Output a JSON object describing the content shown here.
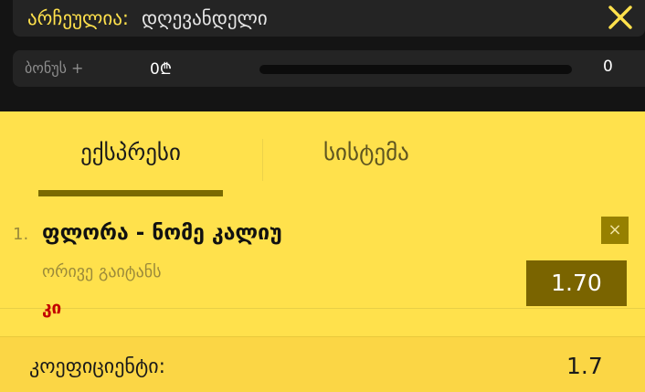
{
  "selection": {
    "label": "არჩეულია:",
    "value": "დღევანდელი"
  },
  "bonus": {
    "label": "ბონუს +",
    "amount": "0₾",
    "count": "0",
    "progress": 0
  },
  "tabs": [
    {
      "label": "ექსპრესი",
      "active": true
    },
    {
      "label": "სისტემა",
      "active": false
    }
  ],
  "bet": {
    "index": "1.",
    "event": "ფლორა - ნომე კალიუ",
    "market": "ორივე გაიტანს",
    "pick": "კი",
    "odd": "1.70",
    "remove_symbol": "×"
  },
  "total": {
    "label": "კოეფიციენტი:",
    "value": "1.7"
  },
  "colors": {
    "accent": "#ffe14c",
    "dark_bg": "#141414",
    "odd_box": "#7a6400",
    "pick_red": "#c20000"
  }
}
